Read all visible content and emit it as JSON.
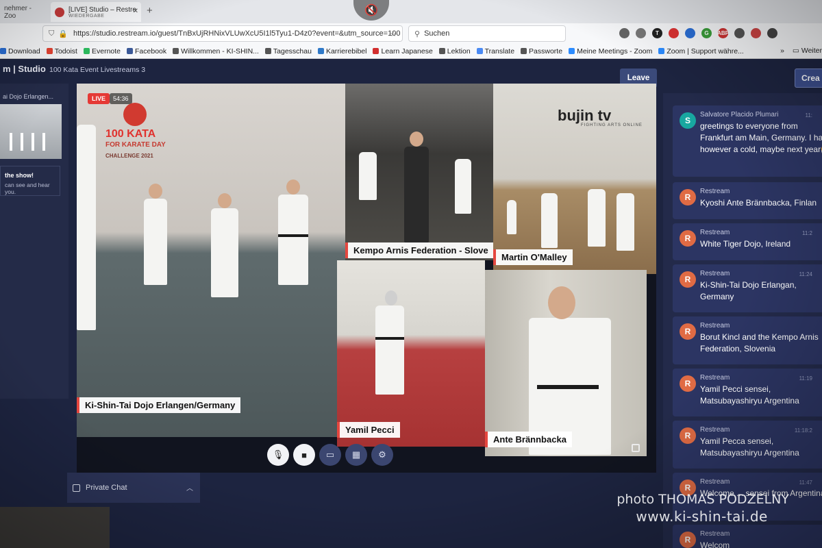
{
  "browser": {
    "tabs": [
      {
        "label": "nehmer - Zoo",
        "active": false
      },
      {
        "label": "[LIVE] Studio – Restre",
        "sub": "WIEDERGABE",
        "active": true
      }
    ],
    "url": "https://studio.restream.io/guest/TnBxUjRHNixVLUwXcU5I1l5Tyu1-D4z0?event=&utm_source=100",
    "search_placeholder": "Suchen",
    "bookmarks": [
      {
        "label": "Download",
        "color": "#2b6fd6"
      },
      {
        "label": "Todoist",
        "color": "#e44332"
      },
      {
        "label": "Evernote",
        "color": "#2dbe60"
      },
      {
        "label": "Facebook",
        "color": "#3b5998"
      },
      {
        "label": "Willkommen - KI-SHIN...",
        "color": "#555555"
      },
      {
        "label": "Tagesschau",
        "color": "#555555"
      },
      {
        "label": "Karrierebibel",
        "color": "#2f79c8"
      },
      {
        "label": "Learn Japanese",
        "color": "#d22f2f"
      },
      {
        "label": "Lektion",
        "color": "#555555"
      },
      {
        "label": "Translate",
        "color": "#4a8af4"
      },
      {
        "label": "Passworte",
        "color": "#555555"
      },
      {
        "label": "Meine Meetings - Zoom",
        "color": "#2d8cff"
      },
      {
        "label": "Zoom | Support währe...",
        "color": "#2d8cff"
      }
    ],
    "bookmarks_overflow": "Weiter"
  },
  "studio": {
    "title": "m | Studio",
    "event_title": "100 Kata Event Livestreams 3",
    "leave_label": "Leave",
    "create_label": "Crea",
    "left_panel": {
      "label": "ai Dojo Erlangen...",
      "show_text": "the show!",
      "hear_text": "can see and hear you."
    },
    "live_label": "LIVE",
    "timer": "54:36",
    "event_logo": {
      "line1": "100 KATA",
      "line2": "FOR KARATE DAY",
      "line3": "CHALLENGE 2021"
    },
    "bujin_logo": "bujin tv",
    "bujin_sub": "FIGHTING ARTS ONLINE",
    "participants": [
      {
        "name": "Ki-Shin-Tai Dojo Erlangen/Germany"
      },
      {
        "name": "Kempo Arnis Federation - Slove"
      },
      {
        "name": "Martin O'Malley"
      },
      {
        "name": "Yamil Pecci"
      },
      {
        "name": "Ante Brännbacka"
      }
    ],
    "private_chat_label": "Private Chat"
  },
  "chat": {
    "messages": [
      {
        "author": "Salvatore Placido Plumari",
        "text": "greetings to everyone from Frankfurt am Main, Germany. I have however a cold, maybe next year🤧",
        "time": "11:",
        "avatar": "S"
      },
      {
        "author": "Restream",
        "text": "Kyoshi Ante Brännbacka, Finlan",
        "time": "",
        "avatar": "R"
      },
      {
        "author": "Restream",
        "text": "White Tiger Dojo, Ireland",
        "time": "11:2",
        "avatar": "R"
      },
      {
        "author": "Restream",
        "text": "Ki-Shin-Tai Dojo Erlangan, Germany",
        "time": "11:24",
        "avatar": "R"
      },
      {
        "author": "Restream",
        "text": "Borut Kincl and the Kempo Arnis Federation, Slovenia",
        "time": "",
        "avatar": "R"
      },
      {
        "author": "Restream",
        "text": "Yamil Pecci sensei, Matsubayashiryu Argentina",
        "time": "11:19",
        "avatar": "R"
      },
      {
        "author": "Restream",
        "text": "Yamil Pecca sensei, Matsubayashiryu Argentina",
        "time": "11:18:2",
        "avatar": "R"
      },
      {
        "author": "Restream",
        "text": "Welcome ... sensei from Argentina",
        "time": "11:47",
        "avatar": "R"
      },
      {
        "author": "Restream",
        "text": "Welcom",
        "time": "",
        "avatar": "R"
      }
    ]
  },
  "watermark": {
    "line1": "photo THOMAS PODZELNY",
    "line2": "www.ki-shin-tai.de"
  }
}
